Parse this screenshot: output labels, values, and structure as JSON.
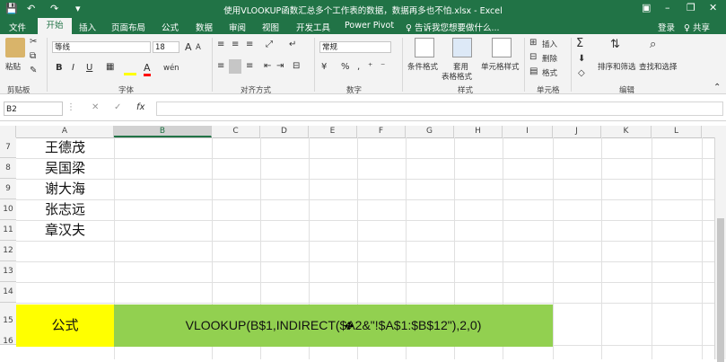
{
  "titlebar": {
    "title": "使用VLOOKUP函数汇总多个工作表的数据，数据再多也不怕.xlsx - Excel",
    "quick_access": {
      "save": "💾",
      "undo": "↶",
      "redo": "↷",
      "customize": "▾"
    },
    "window_buttons": {
      "ribbon_options": "▣",
      "minimize": "–",
      "restore": "❐",
      "close": "✕"
    }
  },
  "tabs": [
    {
      "label": "文件"
    },
    {
      "label": "开始"
    },
    {
      "label": "插入"
    },
    {
      "label": "页面布局"
    },
    {
      "label": "公式"
    },
    {
      "label": "数据"
    },
    {
      "label": "审阅"
    },
    {
      "label": "视图"
    },
    {
      "label": "开发工具"
    },
    {
      "label": "Power Pivot"
    }
  ],
  "tell_me": "♀ 告诉我您想要做什么...",
  "account": {
    "login": "登录",
    "share": "♀ 共享"
  },
  "ribbon": {
    "clipboard": {
      "paste": "粘贴",
      "group": "剪贴板"
    },
    "font": {
      "name": "等线",
      "size": "18",
      "grow": "A",
      "shrink": "A",
      "bold": "B",
      "italic": "I",
      "underline": "U",
      "wen": "wén",
      "group": "字体"
    },
    "align": {
      "group": "对齐方式"
    },
    "number": {
      "format": "常规",
      "percent": "%",
      "comma": ",",
      "group": "数字"
    },
    "styles": {
      "cond": "条件格式",
      "table1": "套用",
      "table2": "表格格式",
      "cell": "单元格样式",
      "group": "样式"
    },
    "cells": {
      "insert": "插入",
      "delete": "删除",
      "format": "格式",
      "group": "单元格"
    },
    "editing": {
      "sum": "Σ",
      "sort": "排序和筛选",
      "find": "查找和选择",
      "group": "编辑"
    }
  },
  "formula_bar": {
    "name_box": "B2",
    "cancel": "✕",
    "enter": "✓",
    "fx": "fx",
    "formula": ""
  },
  "columns": [
    "A",
    "B",
    "C",
    "D",
    "E",
    "F",
    "G",
    "H",
    "I",
    "J",
    "K",
    "L"
  ],
  "rows": [
    {
      "num": "7",
      "a": "王德茂"
    },
    {
      "num": "8",
      "a": "吴国梁"
    },
    {
      "num": "9",
      "a": "谢大海"
    },
    {
      "num": "10",
      "a": "张志远"
    },
    {
      "num": "11",
      "a": "章汉夫"
    },
    {
      "num": "12",
      "a": ""
    },
    {
      "num": "13",
      "a": ""
    },
    {
      "num": "14",
      "a": ""
    },
    {
      "num": "15",
      "a": ""
    },
    {
      "num": "16",
      "a": ""
    }
  ],
  "formula_label": "公式",
  "formula_text": "VLOOKUP(B$1,INDIRECT($A2&\"!$A$1:$B$12\"),2,0)",
  "colors": {
    "excel_green": "#217346",
    "yellow": "#ffff00",
    "light_green": "#92d050"
  }
}
